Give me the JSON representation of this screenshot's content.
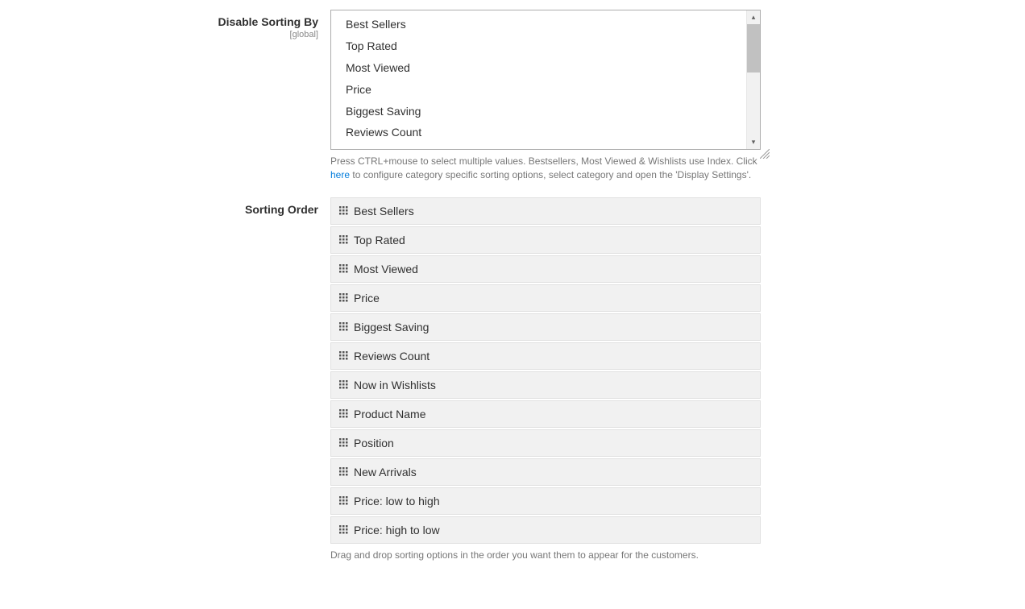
{
  "disable_sorting": {
    "label": "Disable Sorting By",
    "scope": "[global]",
    "options": [
      "Best Sellers",
      "Top Rated",
      "Most Viewed",
      "Price",
      "Biggest Saving",
      "Reviews Count"
    ],
    "help_prefix": "Press CTRL+mouse to select multiple values. Bestsellers, Most Viewed & Wishlists use Index. Click ",
    "help_link": "here",
    "help_suffix": " to configure category specific sorting options, select category and open the 'Display Settings'."
  },
  "sorting_order": {
    "label": "Sorting Order",
    "items": [
      "Best Sellers",
      "Top Rated",
      "Most Viewed",
      "Price",
      "Biggest Saving",
      "Reviews Count",
      "Now in Wishlists",
      "Product Name",
      "Position",
      "New Arrivals",
      "Price: low to high",
      "Price: high to low"
    ],
    "help": "Drag and drop sorting options in the order you want them to appear for the customers."
  }
}
